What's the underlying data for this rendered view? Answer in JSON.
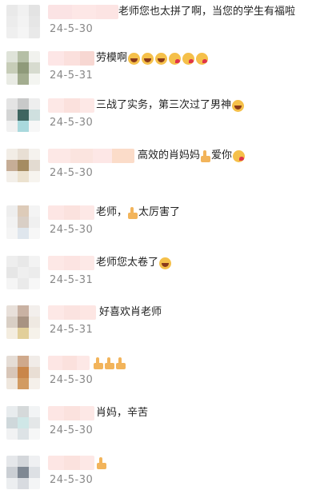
{
  "comments": [
    {
      "text": "老师您也太拼了啊，当您的学生有福啦",
      "date": "24-5-30",
      "emojis_after": [],
      "text_left": 148,
      "avatar": [
        "#e9e9e9",
        "#f1f1f1",
        "#e3e3e3",
        "#ececec",
        "#f3f3f3",
        "#e6e6e6",
        "#efefef",
        "#f5f5f5",
        "#e9e9e9"
      ],
      "name_blocks": [
        [
          "#fbe3e4",
          30
        ],
        [
          "#fde7e6",
          30
        ],
        [
          "#fce4e3",
          28
        ]
      ]
    },
    {
      "text": "劳模啊",
      "date": "24-5-31",
      "emojis_after": [
        "laugh",
        "laugh",
        "laugh",
        "kiss",
        "kiss",
        "kiss"
      ],
      "text_left": 120,
      "avatar": [
        "#dfe3d9",
        "#b5bfa6",
        "#f1f2ee",
        "#c7cdb8",
        "#8f9a7a",
        "#d7dbcf",
        "#e9ebe4",
        "#a3ad8f",
        "#f4f5f1"
      ],
      "name_blocks": [
        [
          "#fde6e6",
          20
        ],
        [
          "#fbe0dd",
          20
        ],
        [
          "#f7d7d2",
          18
        ]
      ]
    },
    {
      "text": "三战了实务，第三次过了男神",
      "date": "24-5-30",
      "emojis_after": [
        "laugh"
      ],
      "text_left": 120,
      "avatar": [
        "#e4e4e4",
        "#c8c9c9",
        "#eeeeee",
        "#d4d5d5",
        "#3e6560",
        "#cfe0df",
        "#f1f1f1",
        "#a9d9dd",
        "#f7f7f7"
      ],
      "name_blocks": [
        [
          "#fde8e6",
          20
        ],
        [
          "#fbe1dd",
          20
        ],
        [
          "#fde8e6",
          18
        ]
      ]
    },
    {
      "text": "高效的肖妈妈",
      "date": "24-5-30",
      "emojis_after": [
        "thumb",
        "text:爱你",
        "kiss"
      ],
      "text_left": 172,
      "avatar": [
        "#f2ede6",
        "#e8dfd4",
        "#f5f2ee",
        "#c6ad96",
        "#a58c62",
        "#e3dbd1",
        "#f3efe9",
        "#ece2cf",
        "#f7f4ef"
      ],
      "name_blocks": [
        [
          "#fde8e6",
          28
        ],
        [
          "#fbe4df",
          28
        ],
        [
          "#fde7e6",
          24
        ],
        [
          "#fbdcc9",
          28
        ]
      ]
    },
    {
      "text": "老师，",
      "date": "24-5-30",
      "emojis_after": [
        "thumb",
        "text:太厉害了"
      ],
      "text_left": 120,
      "avatar": [
        "#eeeeee",
        "#ddcbb9",
        "#f4f4f4",
        "#f2f2f2",
        "#d9cfc6",
        "#f0f0f0",
        "#f5f5f5",
        "#dfe6ed",
        "#f7f7f7"
      ],
      "name_blocks": [
        [
          "#fde6e4",
          20
        ],
        [
          "#fbe2de",
          20
        ],
        [
          "#fde8e6",
          18
        ]
      ]
    },
    {
      "text": "老师您太卷了",
      "date": "24-5-31",
      "emojis_after": [
        "laugh"
      ],
      "text_left": 120,
      "avatar": [
        "#eeeeee",
        "#e8e8e8",
        "#f3f3f3",
        "#e6e6e6",
        "#efefef",
        "#ececec",
        "#f5f5f5",
        "#eaeaea",
        "#f7f7f7"
      ],
      "name_blocks": [
        [
          "#fde8e6",
          20
        ],
        [
          "#fce4e2",
          20
        ],
        [
          "#fde9e7",
          18
        ]
      ]
    },
    {
      "text": "好喜欢肖老师",
      "date": "24-5-31",
      "emojis_after": [],
      "text_left": 124,
      "avatar": [
        "#e8e0da",
        "#c9b2a3",
        "#f3efec",
        "#d9cfc5",
        "#a89382",
        "#efe9e2",
        "#f4ede0",
        "#e2cf9a",
        "#f6f2ea"
      ],
      "name_blocks": [
        [
          "#fde8e6",
          20
        ],
        [
          "#fbe3e0",
          20
        ],
        [
          "#fde6e3",
          20
        ]
      ]
    },
    {
      "text": "",
      "date": "24-5-30",
      "emojis_after": [
        "thumb",
        "thumb",
        "thumb"
      ],
      "text_left": 116,
      "avatar": [
        "#e5ddd6",
        "#cfa98c",
        "#f1ece8",
        "#d8c6b8",
        "#c9864a",
        "#e9ded4",
        "#efe7de",
        "#d29b62",
        "#f5f0ea"
      ],
      "name_blocks": [
        [
          "#fde6e4",
          18
        ],
        [
          "#fbe1dd",
          18
        ],
        [
          "#fde8e6",
          16
        ]
      ]
    },
    {
      "text": "肖妈，辛苦",
      "date": "24-5-30",
      "emojis_after": [],
      "text_left": 120,
      "avatar": [
        "#e8ecee",
        "#d5d9da",
        "#f2f4f5",
        "#cfd8db",
        "#cfe7e7",
        "#e4e7e8",
        "#f1f2f3",
        "#dde3e6",
        "#f6f7f7"
      ],
      "name_blocks": [
        [
          "#fde6e4",
          20
        ],
        [
          "#fbe2de",
          20
        ],
        [
          "#fde8e6",
          18
        ]
      ]
    },
    {
      "text": "",
      "date": "24-5-30",
      "emojis_after": [
        "thumb"
      ],
      "text_left": 120,
      "avatar": [
        "#e5e7ea",
        "#d4d7db",
        "#eff0f2",
        "#cbcfd4",
        "#7f8893",
        "#dde0e4",
        "#eceef0",
        "#d8dbe0",
        "#f4f5f6"
      ],
      "name_blocks": [
        [
          "#fde6e4",
          20
        ],
        [
          "#fbe2de",
          20
        ],
        [
          "#fde8e6",
          18
        ]
      ]
    }
  ]
}
